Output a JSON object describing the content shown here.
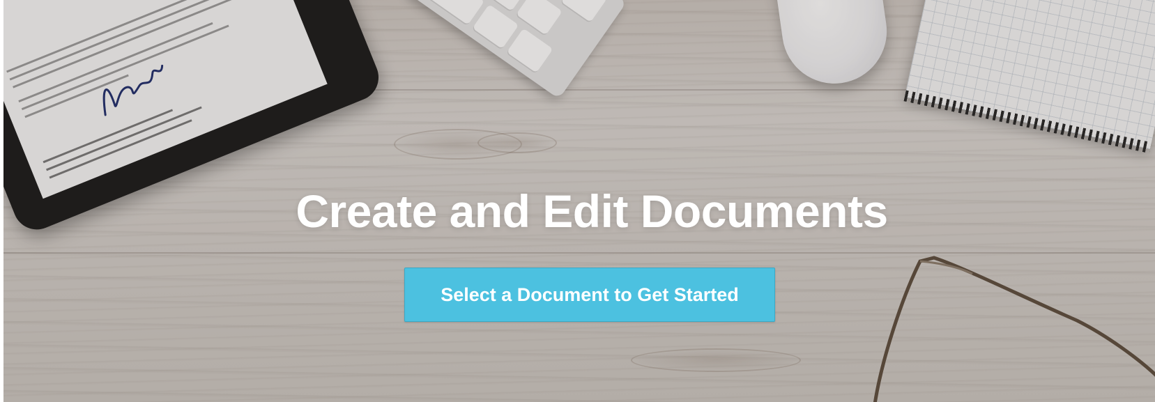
{
  "hero": {
    "title": "Create and Edit Documents",
    "cta_label": "Select a Document to Get Started",
    "accent_color": "#4cc1e0"
  },
  "background": {
    "description_icons": [
      "tablet-icon",
      "keyboard-icon",
      "mouse-icon",
      "notebook-icon",
      "glasses-icon"
    ]
  }
}
